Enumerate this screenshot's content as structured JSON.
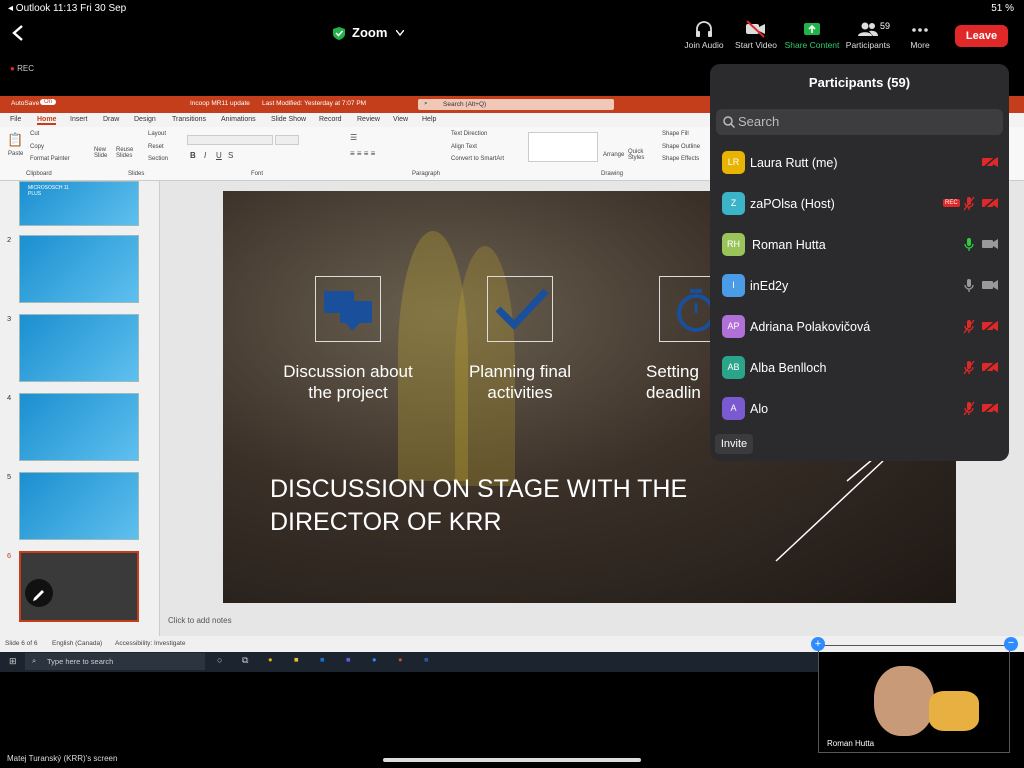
{
  "status": {
    "left": "◂ Outlook  11:13  Fri 30 Sep",
    "right": "51 %"
  },
  "topbar": {
    "title": "Zoom",
    "join_audio": "Join Audio",
    "start_video": "Start Video",
    "share_content": "Share Content",
    "participants": "Participants",
    "participants_count": "59",
    "more": "More",
    "leave": "Leave"
  },
  "rec_badge": "REC",
  "ppt": {
    "autosave": "AutoSave",
    "autosave_state": "On",
    "doc_title": "Incoop MR11 update",
    "last_modified": "Last Modified: Yesterday at 7:07 PM",
    "search": "Search (Alt+Q)",
    "menu": [
      "File",
      "Home",
      "Insert",
      "Draw",
      "Design",
      "Transitions",
      "Animations",
      "Slide Show",
      "Record",
      "Review",
      "View",
      "Help"
    ],
    "groups": [
      "Clipboard",
      "Slides",
      "Font",
      "Paragraph",
      "Drawing"
    ],
    "clipboard": [
      "Cut",
      "Copy",
      "Format Painter"
    ],
    "paste": "Paste",
    "slides_btns": [
      "New Slide",
      "Reuse Slides"
    ],
    "layout_btns": [
      "Layout",
      "Reset",
      "Section"
    ],
    "para_btns": [
      "Text Direction",
      "Align Text",
      "Convert to SmartArt"
    ],
    "arrange": "Arrange",
    "quick_styles": "Quick Styles",
    "shape_btns": [
      "Shape Fill",
      "Shape Outline",
      "Shape Effects"
    ],
    "slide_numbers": [
      "2",
      "3",
      "4",
      "5",
      "6"
    ],
    "slide1_text": "MICROSOSCH 11 PLUS",
    "slide": {
      "item1": "Discussion about the project",
      "item2": "Planning final activities",
      "item3": "Setting deadlin",
      "heading": "DISCUSSION ON STAGE WITH THE DIRECTOR OF KRR"
    },
    "notes": "Click to add notes",
    "footer_slide": "Slide 6 of 6",
    "footer_lang": "English (Canada)",
    "footer_access": "Accessibility: Investigate"
  },
  "taskbar": {
    "search": "Type here to search"
  },
  "panel": {
    "title": "Participants (59)",
    "search_placeholder": "Search",
    "participants": [
      {
        "initials": "LR",
        "name": "Laura Rutt (me)",
        "color": "#e8b400"
      },
      {
        "initials": "Z",
        "name": "zaPOlsa (Host)",
        "color": "#3bb4c8"
      },
      {
        "initials": "RH",
        "name": "Roman Hutta",
        "color": "#9ac45a"
      },
      {
        "initials": "I",
        "name": "inEd2y",
        "color": "#4a9be8"
      },
      {
        "initials": "AP",
        "name": "Adriana Polakovičová",
        "color": "#b070d8"
      },
      {
        "initials": "AB",
        "name": "Alba Benlloch",
        "color": "#2aa58a"
      },
      {
        "initials": "A",
        "name": "Alo",
        "color": "#7a5ad0"
      }
    ],
    "invite": "Invite",
    "rec_small": "REC"
  },
  "video": {
    "name": "Roman Hutta"
  },
  "screen_label": "Matej Turanský (KRR)'s screen"
}
